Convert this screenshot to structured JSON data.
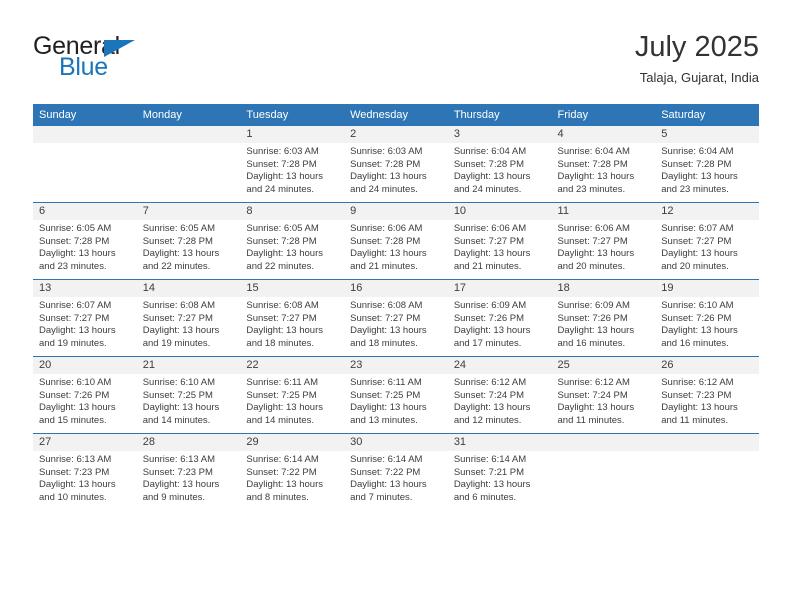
{
  "brand": {
    "name_part1": "General",
    "name_part2": "Blue",
    "accent_color": "#1b75bb"
  },
  "header": {
    "month_title": "July 2025",
    "location": "Talaja, Gujarat, India"
  },
  "theme": {
    "header_blue": "#2e75b6",
    "daynum_band": "#f2f2f2",
    "text": "#3d3d3d"
  },
  "weekday_headers": [
    "Sunday",
    "Monday",
    "Tuesday",
    "Wednesday",
    "Thursday",
    "Friday",
    "Saturday"
  ],
  "weeks": [
    [
      {
        "day": "",
        "lines": []
      },
      {
        "day": "",
        "lines": []
      },
      {
        "day": "1",
        "lines": [
          "Sunrise: 6:03 AM",
          "Sunset: 7:28 PM",
          "Daylight: 13 hours",
          "and 24 minutes."
        ]
      },
      {
        "day": "2",
        "lines": [
          "Sunrise: 6:03 AM",
          "Sunset: 7:28 PM",
          "Daylight: 13 hours",
          "and 24 minutes."
        ]
      },
      {
        "day": "3",
        "lines": [
          "Sunrise: 6:04 AM",
          "Sunset: 7:28 PM",
          "Daylight: 13 hours",
          "and 24 minutes."
        ]
      },
      {
        "day": "4",
        "lines": [
          "Sunrise: 6:04 AM",
          "Sunset: 7:28 PM",
          "Daylight: 13 hours",
          "and 23 minutes."
        ]
      },
      {
        "day": "5",
        "lines": [
          "Sunrise: 6:04 AM",
          "Sunset: 7:28 PM",
          "Daylight: 13 hours",
          "and 23 minutes."
        ]
      }
    ],
    [
      {
        "day": "6",
        "lines": [
          "Sunrise: 6:05 AM",
          "Sunset: 7:28 PM",
          "Daylight: 13 hours",
          "and 23 minutes."
        ]
      },
      {
        "day": "7",
        "lines": [
          "Sunrise: 6:05 AM",
          "Sunset: 7:28 PM",
          "Daylight: 13 hours",
          "and 22 minutes."
        ]
      },
      {
        "day": "8",
        "lines": [
          "Sunrise: 6:05 AM",
          "Sunset: 7:28 PM",
          "Daylight: 13 hours",
          "and 22 minutes."
        ]
      },
      {
        "day": "9",
        "lines": [
          "Sunrise: 6:06 AM",
          "Sunset: 7:28 PM",
          "Daylight: 13 hours",
          "and 21 minutes."
        ]
      },
      {
        "day": "10",
        "lines": [
          "Sunrise: 6:06 AM",
          "Sunset: 7:27 PM",
          "Daylight: 13 hours",
          "and 21 minutes."
        ]
      },
      {
        "day": "11",
        "lines": [
          "Sunrise: 6:06 AM",
          "Sunset: 7:27 PM",
          "Daylight: 13 hours",
          "and 20 minutes."
        ]
      },
      {
        "day": "12",
        "lines": [
          "Sunrise: 6:07 AM",
          "Sunset: 7:27 PM",
          "Daylight: 13 hours",
          "and 20 minutes."
        ]
      }
    ],
    [
      {
        "day": "13",
        "lines": [
          "Sunrise: 6:07 AM",
          "Sunset: 7:27 PM",
          "Daylight: 13 hours",
          "and 19 minutes."
        ]
      },
      {
        "day": "14",
        "lines": [
          "Sunrise: 6:08 AM",
          "Sunset: 7:27 PM",
          "Daylight: 13 hours",
          "and 19 minutes."
        ]
      },
      {
        "day": "15",
        "lines": [
          "Sunrise: 6:08 AM",
          "Sunset: 7:27 PM",
          "Daylight: 13 hours",
          "and 18 minutes."
        ]
      },
      {
        "day": "16",
        "lines": [
          "Sunrise: 6:08 AM",
          "Sunset: 7:27 PM",
          "Daylight: 13 hours",
          "and 18 minutes."
        ]
      },
      {
        "day": "17",
        "lines": [
          "Sunrise: 6:09 AM",
          "Sunset: 7:26 PM",
          "Daylight: 13 hours",
          "and 17 minutes."
        ]
      },
      {
        "day": "18",
        "lines": [
          "Sunrise: 6:09 AM",
          "Sunset: 7:26 PM",
          "Daylight: 13 hours",
          "and 16 minutes."
        ]
      },
      {
        "day": "19",
        "lines": [
          "Sunrise: 6:10 AM",
          "Sunset: 7:26 PM",
          "Daylight: 13 hours",
          "and 16 minutes."
        ]
      }
    ],
    [
      {
        "day": "20",
        "lines": [
          "Sunrise: 6:10 AM",
          "Sunset: 7:26 PM",
          "Daylight: 13 hours",
          "and 15 minutes."
        ]
      },
      {
        "day": "21",
        "lines": [
          "Sunrise: 6:10 AM",
          "Sunset: 7:25 PM",
          "Daylight: 13 hours",
          "and 14 minutes."
        ]
      },
      {
        "day": "22",
        "lines": [
          "Sunrise: 6:11 AM",
          "Sunset: 7:25 PM",
          "Daylight: 13 hours",
          "and 14 minutes."
        ]
      },
      {
        "day": "23",
        "lines": [
          "Sunrise: 6:11 AM",
          "Sunset: 7:25 PM",
          "Daylight: 13 hours",
          "and 13 minutes."
        ]
      },
      {
        "day": "24",
        "lines": [
          "Sunrise: 6:12 AM",
          "Sunset: 7:24 PM",
          "Daylight: 13 hours",
          "and 12 minutes."
        ]
      },
      {
        "day": "25",
        "lines": [
          "Sunrise: 6:12 AM",
          "Sunset: 7:24 PM",
          "Daylight: 13 hours",
          "and 11 minutes."
        ]
      },
      {
        "day": "26",
        "lines": [
          "Sunrise: 6:12 AM",
          "Sunset: 7:23 PM",
          "Daylight: 13 hours",
          "and 11 minutes."
        ]
      }
    ],
    [
      {
        "day": "27",
        "lines": [
          "Sunrise: 6:13 AM",
          "Sunset: 7:23 PM",
          "Daylight: 13 hours",
          "and 10 minutes."
        ]
      },
      {
        "day": "28",
        "lines": [
          "Sunrise: 6:13 AM",
          "Sunset: 7:23 PM",
          "Daylight: 13 hours",
          "and 9 minutes."
        ]
      },
      {
        "day": "29",
        "lines": [
          "Sunrise: 6:14 AM",
          "Sunset: 7:22 PM",
          "Daylight: 13 hours",
          "and 8 minutes."
        ]
      },
      {
        "day": "30",
        "lines": [
          "Sunrise: 6:14 AM",
          "Sunset: 7:22 PM",
          "Daylight: 13 hours",
          "and 7 minutes."
        ]
      },
      {
        "day": "31",
        "lines": [
          "Sunrise: 6:14 AM",
          "Sunset: 7:21 PM",
          "Daylight: 13 hours",
          "and 6 minutes."
        ]
      },
      {
        "day": "",
        "lines": []
      },
      {
        "day": "",
        "lines": []
      }
    ]
  ]
}
